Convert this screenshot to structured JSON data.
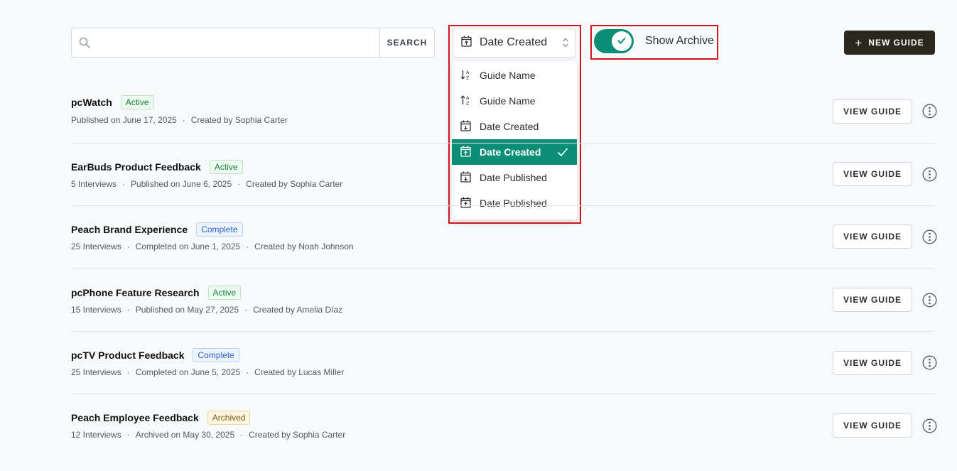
{
  "search": {
    "placeholder": "",
    "value": "",
    "button_label": "SEARCH"
  },
  "sort": {
    "selected_label": "Date Created",
    "options": [
      {
        "label": "Guide Name",
        "icon": "sort-alpha-desc-icon",
        "selected": false
      },
      {
        "label": "Guide Name",
        "icon": "sort-alpha-asc-icon",
        "selected": false
      },
      {
        "label": "Date Created",
        "icon": "calendar-down-icon",
        "selected": false
      },
      {
        "label": "Date Created",
        "icon": "calendar-up-icon",
        "selected": true
      },
      {
        "label": "Date Published",
        "icon": "calendar-down-icon",
        "selected": false
      },
      {
        "label": "Date Published",
        "icon": "calendar-up-icon",
        "selected": false
      }
    ]
  },
  "archive_toggle": {
    "label": "Show Archive",
    "on": true
  },
  "new_guide_button": {
    "label": "NEW GUIDE"
  },
  "colors": {
    "accent": "#0a8e76",
    "dark_button": "#2a281e",
    "highlight": "#d5131c"
  },
  "guides": [
    {
      "title": "pcWatch",
      "status": "Active",
      "meta": [
        "Published on June 17, 2025",
        "Created by Sophia Carter"
      ],
      "button": "VIEW GUIDE"
    },
    {
      "title": "EarBuds Product Feedback",
      "status": "Active",
      "meta": [
        "5 Interviews",
        "Published on June 6, 2025",
        "Created by Sophia Carter"
      ],
      "button": "VIEW GUIDE"
    },
    {
      "title": "Peach Brand Experience",
      "status": "Complete",
      "meta": [
        "25 Interviews",
        "Completed on June 1, 2025",
        "Created by Noah Johnson"
      ],
      "button": "VIEW GUIDE"
    },
    {
      "title": "pcPhone Feature Research",
      "status": "Active",
      "meta": [
        "15 Interviews",
        "Published on May 27, 2025",
        "Created by Amelia Díaz"
      ],
      "button": "VIEW GUIDE"
    },
    {
      "title": "pcTV Product Feedback",
      "status": "Complete",
      "meta": [
        "25 Interviews",
        "Completed on June 5, 2025",
        "Created by Lucas Miller"
      ],
      "button": "VIEW GUIDE"
    },
    {
      "title": "Peach Employee Feedback",
      "status": "Archived",
      "meta": [
        "12 Interviews",
        "Archived on May 30, 2025",
        "Created by Sophia Carter"
      ],
      "button": "VIEW GUIDE"
    }
  ]
}
